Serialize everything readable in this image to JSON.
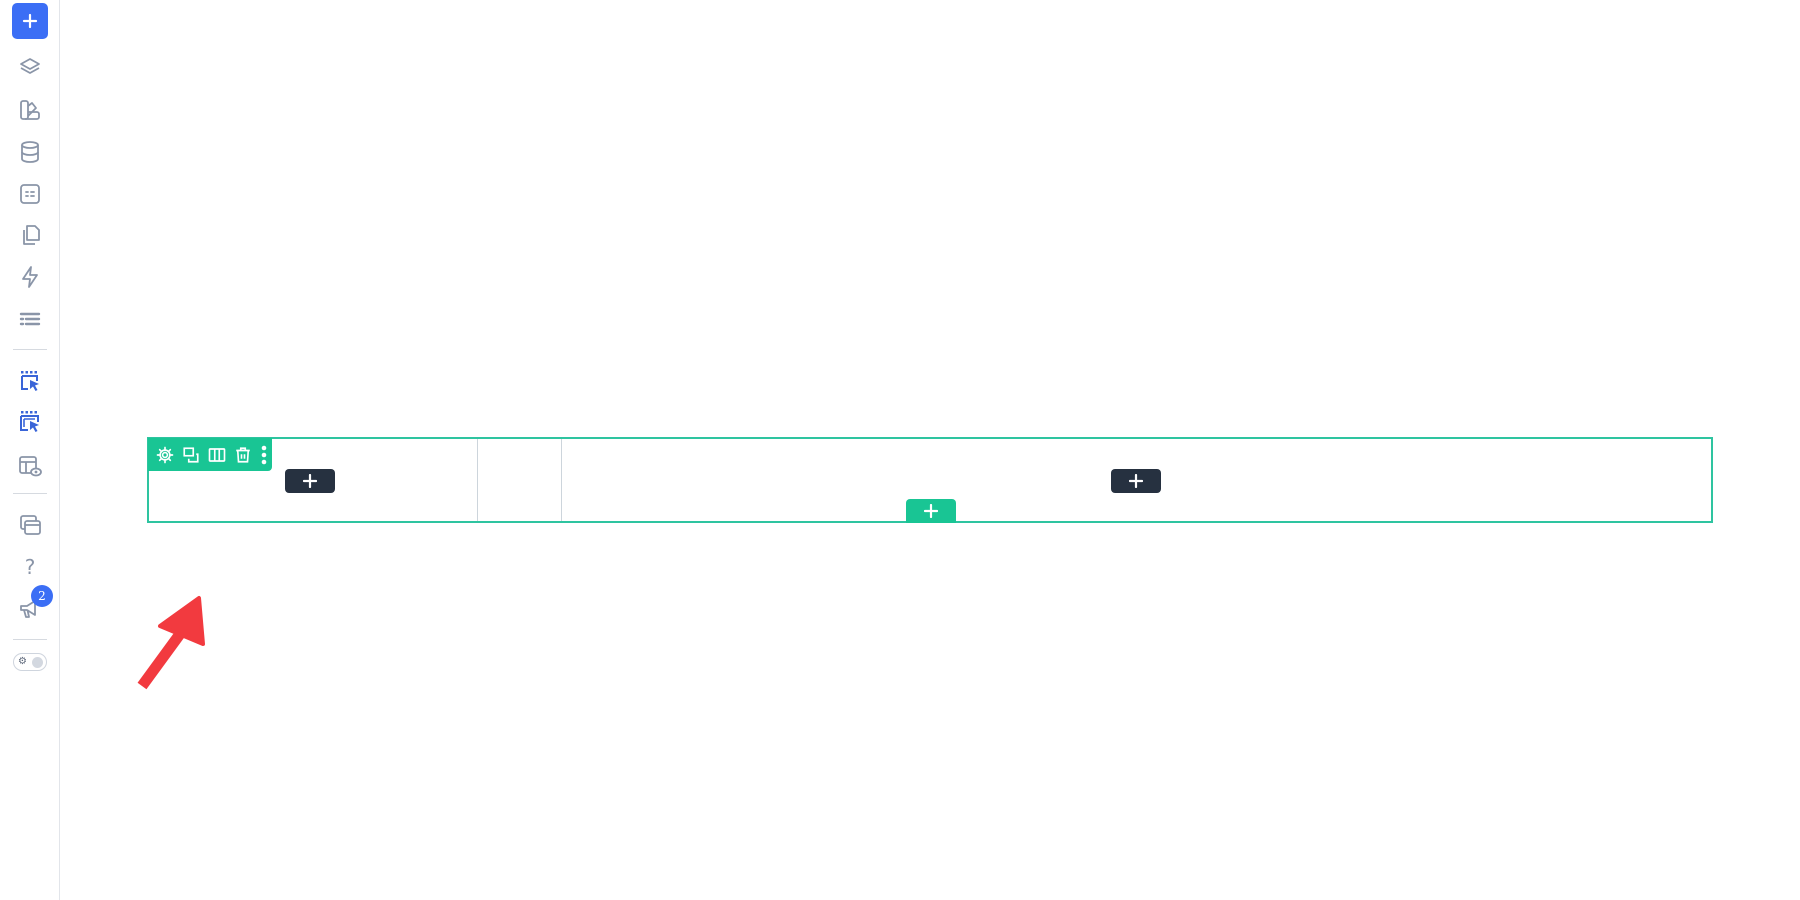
{
  "sidebar": {
    "add_button_icon": "plus-icon",
    "items": [
      {
        "icon": "layers-icon"
      },
      {
        "icon": "styles-icon"
      },
      {
        "icon": "database-icon"
      },
      {
        "icon": "form-icon"
      },
      {
        "icon": "pages-icon"
      },
      {
        "icon": "lightning-icon"
      },
      {
        "icon": "list-icon"
      },
      {
        "icon": "select-element-icon"
      },
      {
        "icon": "select-multiple-icon"
      },
      {
        "icon": "layout-preview-icon"
      },
      {
        "icon": "windows-icon"
      },
      {
        "icon": "help-icon"
      },
      {
        "icon": "announcement-icon"
      }
    ],
    "help_glyph": "?",
    "announcement_badge": "2",
    "theme_toggle_icon": "⚙"
  },
  "row_toolbar": {
    "icons": [
      "settings-icon",
      "duplicate-icon",
      "columns-icon",
      "delete-icon",
      "more-icon"
    ]
  },
  "colors": {
    "accent": "#3b6ef5",
    "row_border": "#2ec4a0",
    "toolbar_bg": "#19c594",
    "dark_button": "#263140",
    "arrow": "#f23a3f"
  }
}
